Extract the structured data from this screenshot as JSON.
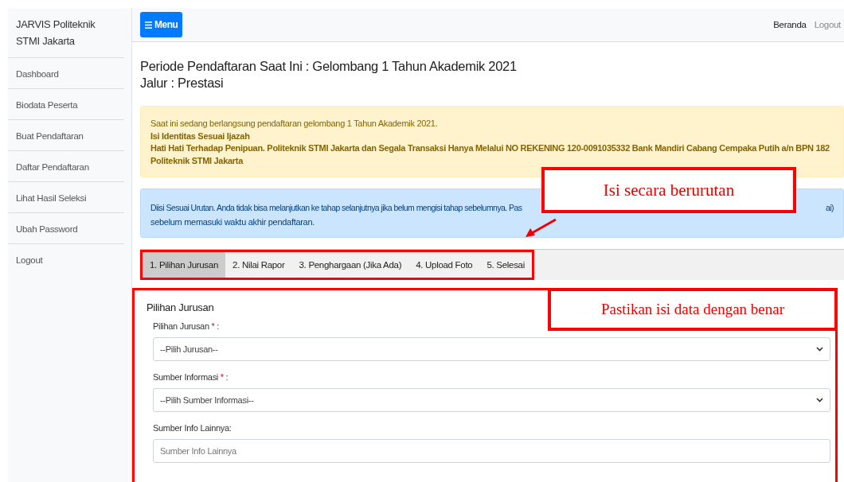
{
  "sidebar": {
    "brand": "JARVIS Politeknik STMI Jakarta",
    "items": [
      {
        "label": "Dashboard"
      },
      {
        "label": "Biodata Peserta"
      },
      {
        "label": "Buat Pendaftaran"
      },
      {
        "label": "Daftar Pendaftaran"
      },
      {
        "label": "Lihat Hasil Seleksi"
      },
      {
        "label": "Ubah Password"
      },
      {
        "label": "Logout"
      }
    ]
  },
  "navbar": {
    "menu_button": "Menu",
    "links": [
      {
        "label": "Beranda",
        "active": true
      },
      {
        "label": "Logout",
        "active": false
      }
    ]
  },
  "heading": [
    "Periode Pendaftaran Saat Ini : Gelombang 1 Tahun Akademik 2021",
    "Jalur : Prestasi"
  ],
  "warning_alert": {
    "lines": [
      {
        "text": "Saat ini sedang berlangsung pendaftaran gelombang 1 Tahun Akademik 2021.",
        "bold": false
      },
      {
        "text": "Isi Identitas Sesuai Ijazah",
        "bold": true
      },
      {
        "text": "Hati Hati Terhadap Penipuan. Politeknik STMI Jakarta dan Segala Transaksi Hanya Melalui NO REKENING 120-0091035332 Bank Mandiri Cabang Cempaka Putih a/n BPN 182 Politeknik STMI Jakarta",
        "bold": true
      }
    ]
  },
  "info_alert": {
    "line_1_start": "Diisi Sesuai Urutan. Anda tidak bisa melanjutkan ke tahap selanjutnya jika belum mengisi tahap sebelumnya. Pas",
    "line_1_end": "ai)",
    "line_2": "sebelum memasuki waktu akhir pendaftaran."
  },
  "tabs": [
    {
      "label": "1. Pilihan Jurusan",
      "selected": true
    },
    {
      "label": "2. Nilai Rapor",
      "selected": false
    },
    {
      "label": "3. Penghargaan (Jika Ada)",
      "selected": false
    },
    {
      "label": "4. Upload Foto",
      "selected": false
    },
    {
      "label": "5. Selesai",
      "selected": false
    }
  ],
  "form": {
    "title": "Pilihan Jurusan",
    "fields": [
      {
        "kind": "select",
        "label": "Pilihan Jurusan",
        "required_mark": "*",
        "label_end": ":",
        "value": "--Pilih Jurusan--"
      },
      {
        "kind": "select",
        "label": "Sumber Informasi",
        "required_mark": "*",
        "label_end": ":",
        "value": "--Pilih Sumber Informasi--"
      },
      {
        "kind": "text",
        "label": "Sumber Info Lainnya:",
        "placeholder": "Sumber Info Lainnya"
      }
    ]
  },
  "annotations": [
    {
      "kind": "callout",
      "text": "Isi secara berurutan"
    },
    {
      "kind": "arrow"
    },
    {
      "kind": "callout",
      "text": "Pastikan isi data dengan benar"
    }
  ]
}
